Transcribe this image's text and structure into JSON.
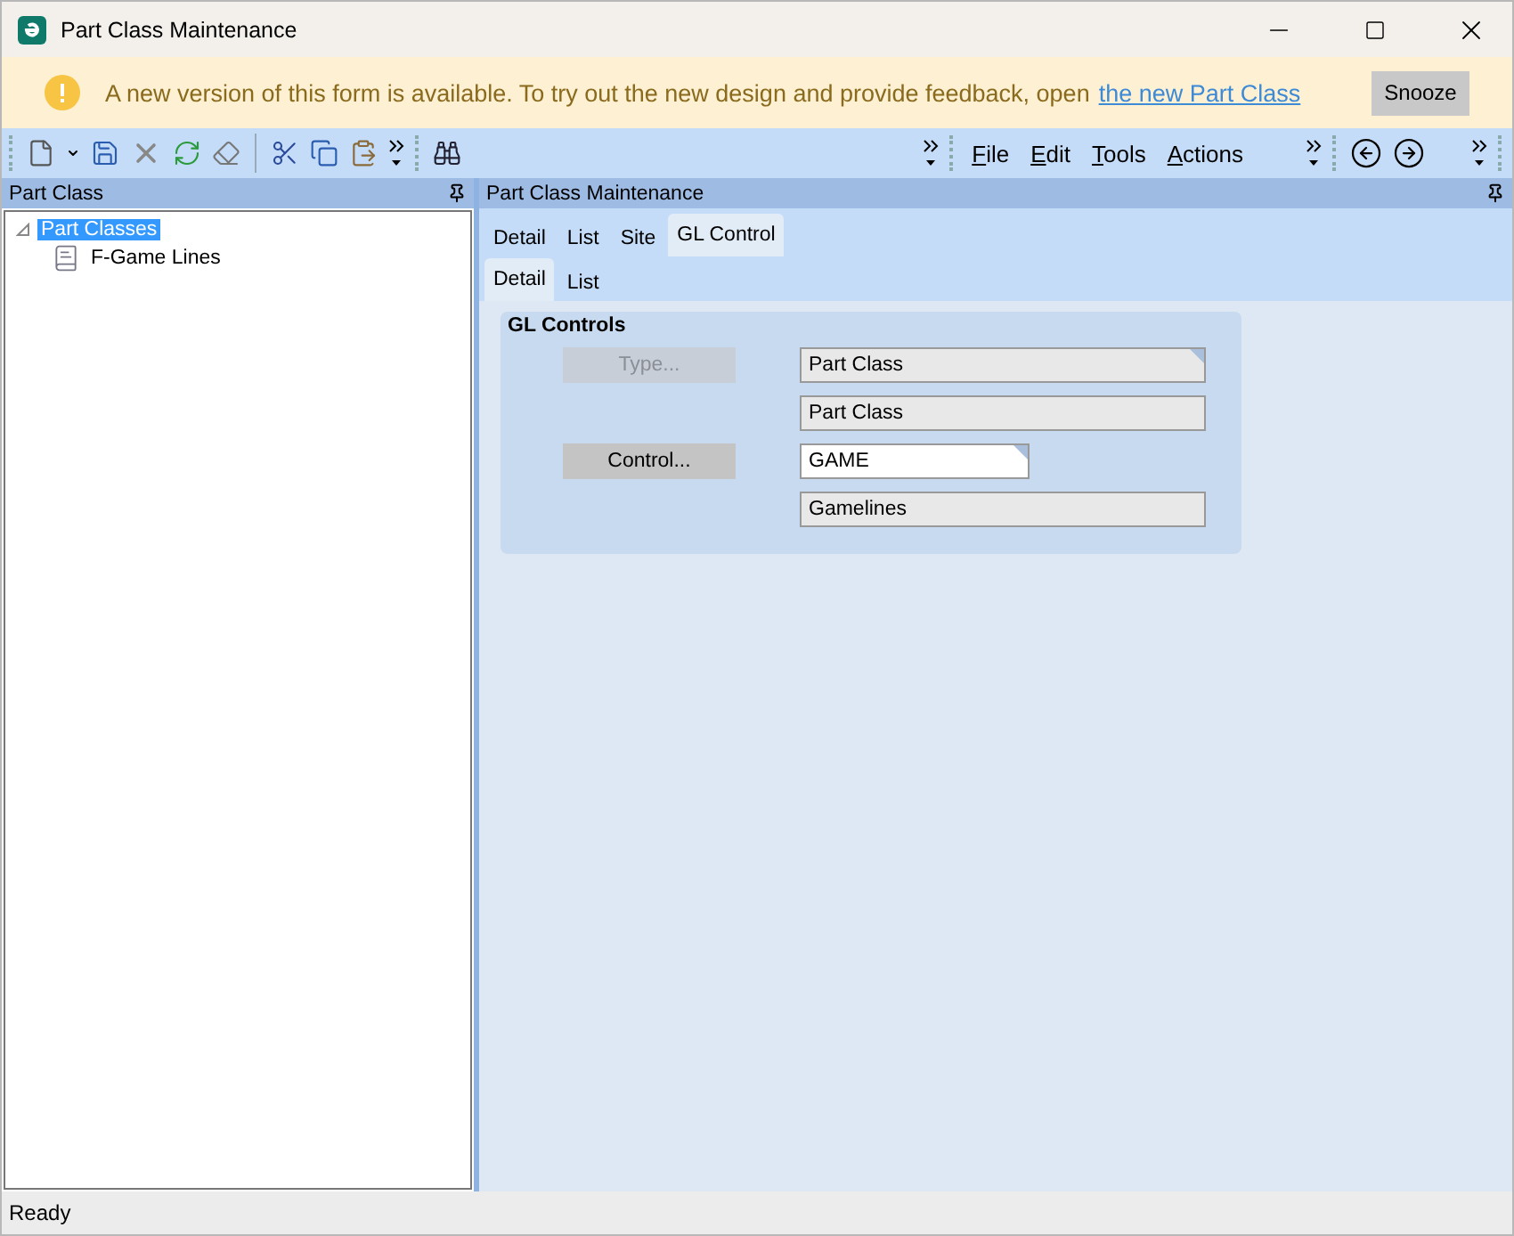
{
  "window": {
    "title": "Part Class Maintenance"
  },
  "banner": {
    "message": "A new version of this form is available. To try out the new design and provide feedback, open",
    "link": "the new Part Class",
    "button": "Snooze"
  },
  "menu": [
    {
      "label": "File"
    },
    {
      "label": "Edit"
    },
    {
      "label": "Tools"
    },
    {
      "label": "Actions"
    }
  ],
  "left_pane": {
    "title": "Part Class",
    "tree": [
      {
        "label": "Part Classes",
        "selected": true,
        "expanded": true,
        "children": [
          {
            "label": "F-Game Lines",
            "selected": false
          }
        ]
      }
    ]
  },
  "right_pane": {
    "title": "Part Class Maintenance",
    "tabs": [
      {
        "label": "Detail",
        "selected": false
      },
      {
        "label": "List",
        "selected": false
      },
      {
        "label": "Site",
        "selected": false
      },
      {
        "label": "GL Control",
        "selected": true
      }
    ],
    "subtabs": [
      {
        "label": "Detail",
        "selected": true
      },
      {
        "label": "List",
        "selected": false
      }
    ],
    "group": {
      "title": "GL Controls",
      "rows": [
        {
          "button": {
            "label": "Type...",
            "disabled": true
          },
          "field": {
            "value": "Part Class",
            "readonly": true,
            "flagged": true,
            "wide": true
          }
        },
        {
          "field": {
            "value": "Part Class",
            "readonly": true,
            "flagged": false,
            "wide": true
          }
        },
        {
          "button": {
            "label": "Control...",
            "disabled": false
          },
          "field": {
            "value": "GAME",
            "readonly": false,
            "flagged": true,
            "wide": false
          }
        },
        {
          "field": {
            "value": "Gamelines",
            "readonly": true,
            "flagged": false,
            "wide": true
          }
        }
      ]
    }
  },
  "status_bar": {
    "text": "Ready"
  }
}
